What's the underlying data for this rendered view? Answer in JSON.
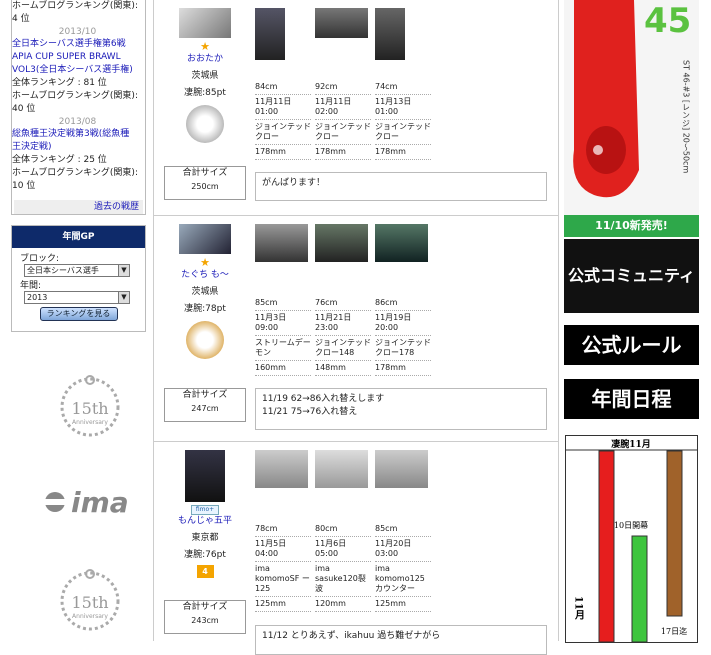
{
  "left": {
    "history": [
      {
        "kind": "text",
        "text": "ホームブログランキング(関東):"
      },
      {
        "kind": "text",
        "text": "4 位"
      },
      {
        "kind": "date",
        "text": "2013/10"
      },
      {
        "kind": "link",
        "text": "全日本シーバス選手権第6戦"
      },
      {
        "kind": "link",
        "text": "APIA CUP SUPER BRAWL"
      },
      {
        "kind": "link",
        "text": "VOL3(全日本シーバス選手権)"
      },
      {
        "kind": "text",
        "text": "全体ランキング : 81 位"
      },
      {
        "kind": "text",
        "text": "ホームブログランキング(関東):"
      },
      {
        "kind": "text",
        "text": "40 位"
      },
      {
        "kind": "date",
        "text": "2013/08"
      },
      {
        "kind": "link",
        "text": "総魚種王決定戦第3戦(総魚種"
      },
      {
        "kind": "link",
        "text": "王決定戦)"
      },
      {
        "kind": "text",
        "text": "全体ランキング : 25 位"
      },
      {
        "kind": "text",
        "text": "ホームブログランキング(関東):"
      },
      {
        "kind": "text",
        "text": "10 位"
      }
    ],
    "past_link": "過去の戦歴",
    "gp": {
      "title": "年間GP",
      "block_label": "ブロック:",
      "block_value": "全日本シーバス選手",
      "year_label": "年間:",
      "year_value": "2013",
      "button": "ランキングを見る"
    },
    "anniv_text": "15th",
    "anniv_sub": "Anniversary",
    "ima_logo": "ima"
  },
  "entries": [
    {
      "name": "おおたか",
      "pref": "茨城県",
      "points": "凄腕:85pt",
      "rank_icon": "star",
      "trophy": "silver",
      "total_label": "合計サイズ",
      "total_value": "250cm",
      "catches": [
        {
          "size": "84cm",
          "date": "11月11日",
          "time": "01:00",
          "lure": "ジョインテッドクロー",
          "lure2": "",
          "length": "178mm"
        },
        {
          "size": "92cm",
          "date": "11月11日",
          "time": "02:00",
          "lure": "ジョインテッドクロー",
          "lure2": "",
          "length": "178mm"
        },
        {
          "size": "74cm",
          "date": "11月13日",
          "time": "01:00",
          "lure": "ジョインテッドクロー",
          "lure2": "",
          "length": "178mm"
        }
      ],
      "comment": [
        "がんばります！"
      ]
    },
    {
      "name": "たぐち も～",
      "pref": "茨城県",
      "points": "凄腕:78pt",
      "rank_icon": "star",
      "trophy": "gold",
      "total_label": "合計サイズ",
      "total_value": "247cm",
      "catches": [
        {
          "size": "85cm",
          "date": "11月3日",
          "time": "09:00",
          "lure": "ストリームデーモン",
          "lure2": "",
          "length": "160mm"
        },
        {
          "size": "76cm",
          "date": "11月21日",
          "time": "23:00",
          "lure": "ジョインテッドクロー148",
          "lure2": "",
          "length": "148mm"
        },
        {
          "size": "86cm",
          "date": "11月19日",
          "time": "20:00",
          "lure": "ジョインテッドクロー178",
          "lure2": "",
          "length": "178mm"
        }
      ],
      "comment": [
        "11/19 62→86入れ替えします",
        "11/21 75→76入れ替え"
      ]
    },
    {
      "name": "もんじゃ五平",
      "pref": "東京都",
      "points": "凄腕:76pt",
      "rank_badge": "4",
      "fimo": "fimo+",
      "total_label": "合計サイズ",
      "total_value": "243cm",
      "catches": [
        {
          "size": "78cm",
          "date": "11月5日",
          "time": "04:00",
          "lure": "ima komomoSF ー125",
          "lure2": "",
          "length": "125mm"
        },
        {
          "size": "80cm",
          "date": "11月6日",
          "time": "05:00",
          "lure": "ima sasuke120裂波",
          "lure2": "",
          "length": "120mm"
        },
        {
          "size": "85cm",
          "date": "11月20日",
          "time": "03:00",
          "lure": "ima komomo125カウンター",
          "lure2": "",
          "length": "125mm"
        }
      ],
      "comment": [
        "11/12 とりあえず、ikahuu 過ち難ゼナがら"
      ]
    }
  ],
  "right": {
    "new_release": "11/10新発売!",
    "product_spec": "ST 46-#3 [レンジ] 20〜50cm",
    "product_num": "45",
    "community_banner": "公式コミュニティ",
    "rules_banner": "公式ルール",
    "schedule_banner": "年間日程",
    "calendar": {
      "title": "凄腕11月",
      "month": "11月",
      "start_label": "10日開幕",
      "end_label": "17日迄"
    }
  },
  "colors": {
    "link": "#1a1ab8",
    "gp_header": "#0e2a6a",
    "new_sale": "#2ea84a",
    "rank_badge": "#f4a400"
  }
}
